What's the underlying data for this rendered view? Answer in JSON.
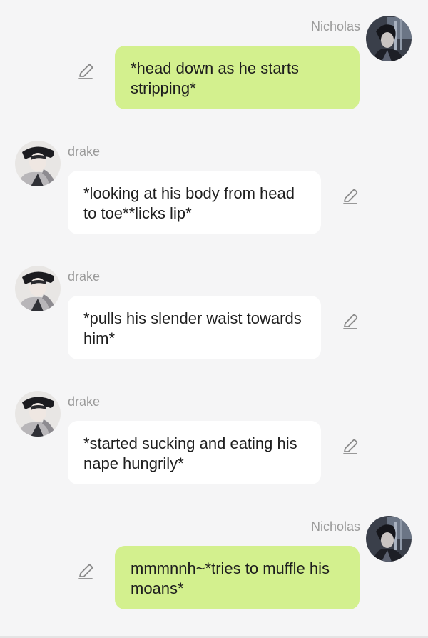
{
  "messages": [
    {
      "sender": "Nicholas",
      "role": "user",
      "text": "*head down as he starts stripping*",
      "avatar_icon": "nicholas-avatar"
    },
    {
      "sender": "drake",
      "role": "character",
      "text": "*looking at his body from head to toe**licks lip*",
      "avatar_icon": "drake-avatar"
    },
    {
      "sender": "drake",
      "role": "character",
      "text": "*pulls his slender waist towards him*",
      "avatar_icon": "drake-avatar"
    },
    {
      "sender": "drake",
      "role": "character",
      "text": "*started sucking and eating his nape hungrily*",
      "avatar_icon": "drake-avatar"
    },
    {
      "sender": "Nicholas",
      "role": "user",
      "text": "mmmnnh~*tries to muffle his moans*",
      "avatar_icon": "nicholas-avatar"
    }
  ],
  "colors": {
    "background": "#f5f5f6",
    "user_bubble": "#d3f08e",
    "character_bubble": "#ffffff",
    "sender_name": "#9a9a9a",
    "message_text": "#1e1e1e",
    "edit_icon": "#8a8a8a"
  },
  "icons": {
    "edit": "pencil-icon"
  }
}
